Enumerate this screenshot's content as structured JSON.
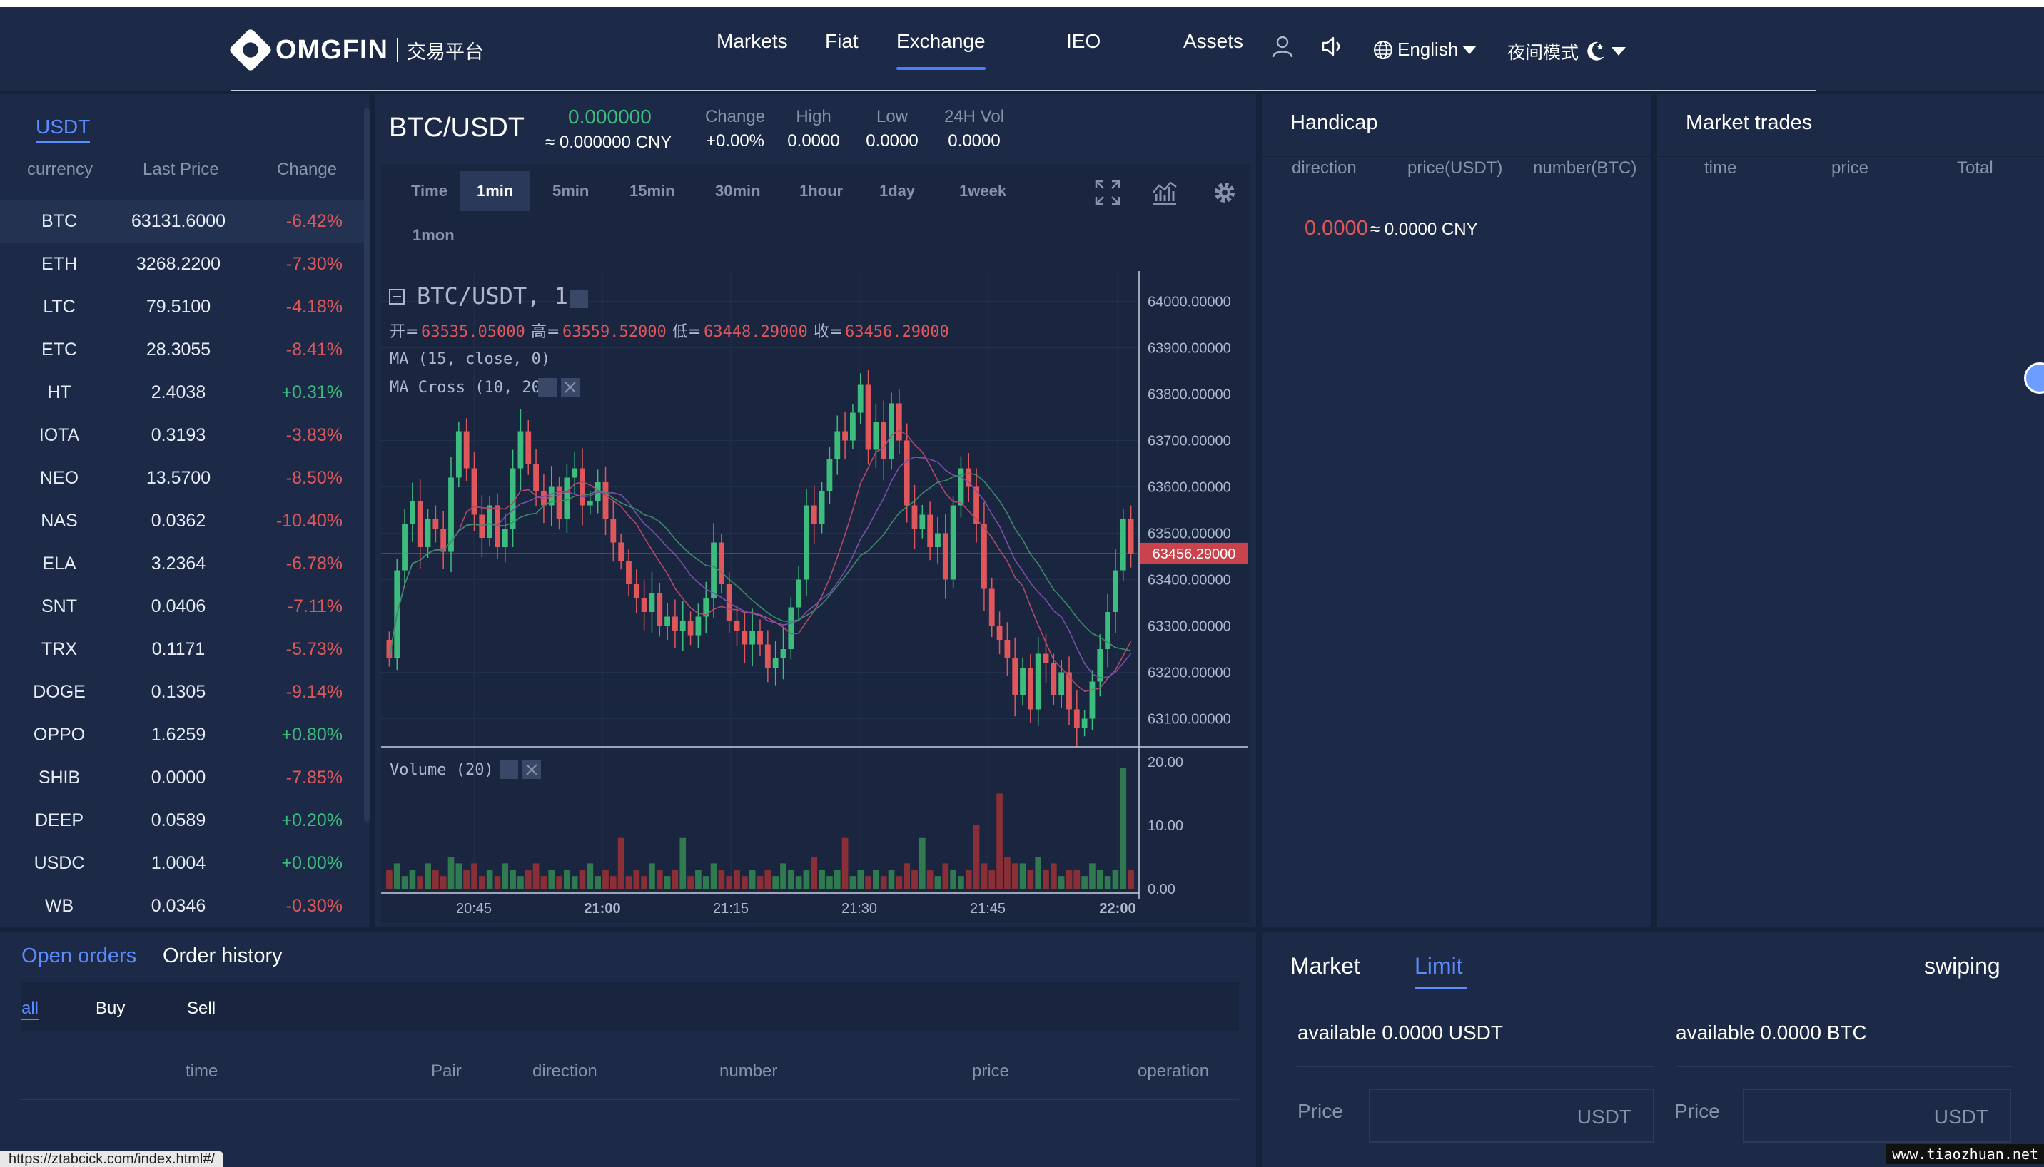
{
  "header": {
    "brand": "OMGFIN",
    "brand_sub": "交易平台",
    "nav": [
      "Markets",
      "Fiat",
      "Exchange",
      "IEO",
      "Assets"
    ],
    "language": "English",
    "night_mode": "夜间模式"
  },
  "market_list": {
    "tab": "USDT",
    "columns": [
      "currency",
      "Last Price",
      "Change"
    ],
    "rows": [
      {
        "name": "BTC",
        "price": "63131.6000",
        "change": "-6.42%"
      },
      {
        "name": "ETH",
        "price": "3268.2200",
        "change": "-7.30%"
      },
      {
        "name": "LTC",
        "price": "79.5100",
        "change": "-4.18%"
      },
      {
        "name": "ETC",
        "price": "28.3055",
        "change": "-8.41%"
      },
      {
        "name": "HT",
        "price": "2.4038",
        "change": "+0.31%"
      },
      {
        "name": "IOTA",
        "price": "0.3193",
        "change": "-3.83%"
      },
      {
        "name": "NEO",
        "price": "13.5700",
        "change": "-8.50%"
      },
      {
        "name": "NAS",
        "price": "0.0362",
        "change": "-10.40%"
      },
      {
        "name": "ELA",
        "price": "3.2364",
        "change": "-6.78%"
      },
      {
        "name": "SNT",
        "price": "0.0406",
        "change": "-7.11%"
      },
      {
        "name": "TRX",
        "price": "0.1171",
        "change": "-5.73%"
      },
      {
        "name": "DOGE",
        "price": "0.1305",
        "change": "-9.14%"
      },
      {
        "name": "OPPO",
        "price": "1.6259",
        "change": "+0.80%"
      },
      {
        "name": "SHIB",
        "price": "0.0000",
        "change": "-7.85%"
      },
      {
        "name": "DEEP",
        "price": "0.0589",
        "change": "+0.20%"
      },
      {
        "name": "USDC",
        "price": "1.0004",
        "change": "+0.00%"
      },
      {
        "name": "WB",
        "price": "0.0346",
        "change": "-0.30%"
      }
    ]
  },
  "ticker": {
    "pair": "BTC/USDT",
    "last": "0.000000",
    "last_cny": "≈ 0.000000 CNY",
    "change_label": "Change",
    "change_value": "+0.00%",
    "high_label": "High",
    "high_value": "0.0000",
    "low_label": "Low",
    "low_value": "0.0000",
    "vol_label": "24H Vol",
    "vol_value": "0.0000"
  },
  "intervals": [
    "Time",
    "1min",
    "5min",
    "15min",
    "30min",
    "1hour",
    "1day",
    "1week",
    "1mon"
  ],
  "chart_data": {
    "type": "candlestick",
    "title": "BTC/USDT, 1",
    "ohlc_labels": [
      {
        "label": "开=",
        "value": "63535.05000"
      },
      {
        "label": "高=",
        "value": "63559.52000"
      },
      {
        "label": "低=",
        "value": "63448.29000"
      },
      {
        "label": "收=",
        "value": "63456.29000"
      }
    ],
    "studies": [
      "MA (15, close, 0)",
      "MA Cross (10, 20)"
    ],
    "volume_label": "Volume (20)",
    "last_price_tag": "63456.29000",
    "price_ticks": [
      "64000.00000",
      "63900.00000",
      "63800.00000",
      "63700.00000",
      "63600.00000",
      "63500.00000",
      "63400.00000",
      "63300.00000",
      "63200.00000",
      "63100.00000"
    ],
    "volume_ticks": [
      "20.00",
      "10.00",
      "0.00"
    ],
    "time_ticks": [
      "20:45",
      "21:00",
      "21:15",
      "21:30",
      "21:45",
      "22:00"
    ],
    "ylim": [
      63050,
      64050
    ],
    "vol_ylim": [
      0,
      22
    ],
    "closes": [
      63230,
      63420,
      63520,
      63570,
      63470,
      63530,
      63510,
      63460,
      63620,
      63720,
      63640,
      63540,
      63490,
      63560,
      63470,
      63510,
      63640,
      63720,
      63650,
      63590,
      63560,
      63600,
      63530,
      63620,
      63640,
      63560,
      63570,
      63610,
      63530,
      63480,
      63440,
      63390,
      63360,
      63330,
      63370,
      63300,
      63320,
      63290,
      63310,
      63280,
      63320,
      63360,
      63480,
      63390,
      63310,
      63290,
      63260,
      63290,
      63260,
      63210,
      63230,
      63250,
      63340,
      63400,
      63560,
      63520,
      63590,
      63660,
      63720,
      63700,
      63760,
      63820,
      63680,
      63740,
      63660,
      63780,
      63700,
      63560,
      63510,
      63540,
      63470,
      63500,
      63400,
      63560,
      63640,
      63600,
      63520,
      63380,
      63300,
      63270,
      63230,
      63150,
      63210,
      63120,
      63240,
      63220,
      63150,
      63200,
      63120,
      63080,
      63100,
      63180,
      63250,
      63330,
      63420,
      63530,
      63456
    ],
    "volumes": [
      3,
      4,
      2,
      3,
      2,
      4,
      3,
      2,
      5,
      4,
      3,
      4,
      2,
      3,
      2,
      4,
      3,
      2,
      3,
      4,
      2,
      3,
      2,
      3,
      2,
      3,
      4,
      2,
      3,
      2,
      8,
      2,
      3,
      2,
      4,
      3,
      2,
      3,
      8,
      2,
      3,
      2,
      4,
      3,
      2,
      3,
      2,
      3,
      2,
      3,
      2,
      4,
      3,
      2,
      3,
      5,
      3,
      2,
      3,
      8,
      2,
      3,
      2,
      3,
      2,
      3,
      2,
      4,
      3,
      8,
      3,
      2,
      4,
      3,
      2,
      3,
      10,
      4,
      3,
      15,
      5,
      4,
      4,
      3,
      5,
      3,
      4,
      2,
      3,
      3,
      2,
      4,
      3,
      2,
      3,
      19,
      3
    ]
  },
  "handicap": {
    "title": "Handicap",
    "columns": [
      "direction",
      "price(USDT)",
      "number(BTC)"
    ],
    "price": "0.0000",
    "cny": "≈ 0.0000 CNY"
  },
  "market_trades": {
    "title": "Market trades",
    "columns": [
      "time",
      "price",
      "Total"
    ]
  },
  "orders": {
    "tabs": [
      "Open orders",
      "Order history"
    ],
    "filters": [
      "all",
      "Buy",
      "Sell"
    ],
    "columns": [
      "time",
      "Pair",
      "direction",
      "number",
      "price",
      "operation"
    ]
  },
  "trade_form": {
    "tabs": [
      "Market",
      "Limit"
    ],
    "swiping": "swiping",
    "buy_available": "available 0.0000 USDT",
    "sell_available": "available 0.0000 BTC",
    "price_label": "Price",
    "unit": "USDT"
  },
  "status_url": "https://ztabcick.com/index.html#/",
  "watermark": "www.tiaozhuan.net",
  "colors": {
    "up": "#3dbd7d",
    "down": "#e0575b",
    "accent": "#5b8cff",
    "panel": "#1c2a47"
  }
}
